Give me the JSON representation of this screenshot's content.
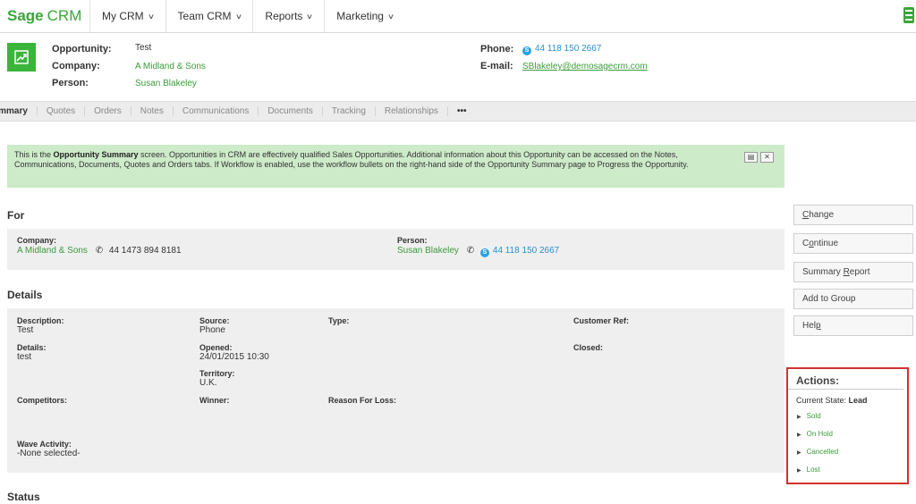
{
  "nav": {
    "logo_main": "Sage",
    "logo_sub": "CRM",
    "items": [
      "My CRM",
      "Team CRM",
      "Reports",
      "Marketing"
    ]
  },
  "header": {
    "opportunity_label": "Opportunity:",
    "opportunity_value": "Test",
    "company_label": "Company:",
    "company_value": "A Midland & Sons",
    "person_label": "Person:",
    "person_value": "Susan Blakeley",
    "phone_label": "Phone:",
    "phone_value": "44 118 150 2667",
    "email_label": "E-mail:",
    "email_value": "SBlakeley@demosagecrm.com"
  },
  "tabs": [
    "ummary",
    "Quotes",
    "Orders",
    "Notes",
    "Communications",
    "Documents",
    "Tracking",
    "Relationships",
    "•••"
  ],
  "banner": {
    "pre": "This is the ",
    "bold": "Opportunity Summary",
    "post": " screen. Opportunities in CRM are effectively qualified Sales Opportunities. Additional information about this Opportunity can be accessed on the Notes, Communications, Documents, Quotes and Orders tabs. If Workflow is enabled, use the workflow bullets on the right-hand side of the Opportunity Summary page to Progress the Opportunity."
  },
  "for_section": {
    "title": "For",
    "company_label": "Company:",
    "company_value": "A Midland & Sons",
    "company_phone": "44 1473 894 8181",
    "person_label": "Person:",
    "person_value": "Susan Blakeley",
    "person_phone": "44 118 150 2667"
  },
  "details": {
    "title": "Details",
    "description_label": "Description:",
    "description_value": "Test",
    "source_label": "Source:",
    "source_value": "Phone",
    "type_label": "Type:",
    "customer_ref_label": "Customer Ref:",
    "details_label": "Details:",
    "details_value": "test",
    "opened_label": "Opened:",
    "opened_value": "24/01/2015 10:30",
    "closed_label": "Closed:",
    "territory_label": "Territory:",
    "territory_value": "U.K.",
    "competitors_label": "Competitors:",
    "winner_label": "Winner:",
    "reason_label": "Reason For Loss:",
    "wave_label": "Wave Activity:",
    "wave_value": "-None selected-"
  },
  "status_title": "Status",
  "buttons": {
    "change_u": "C",
    "change_rest": "hange",
    "continue_pre": "C",
    "continue_u": "o",
    "continue_rest": "ntinue",
    "summary_pre": "Summary ",
    "summary_u": "R",
    "summary_rest": "eport",
    "add_group": "Add to Group",
    "help_pre": "Hel",
    "help_u": "p"
  },
  "actions": {
    "title": "Actions:",
    "state_label": "Current State: ",
    "state_value": "Lead",
    "items": [
      "Sold",
      "On Hold",
      "Cancelled",
      "Lost"
    ]
  },
  "colors": {
    "brand_green": "#3aa63a",
    "link_green": "#3c9b3c",
    "link_blue": "#2a8fc9",
    "banner_bg": "#cdeac9",
    "actions_border": "#d23030"
  }
}
